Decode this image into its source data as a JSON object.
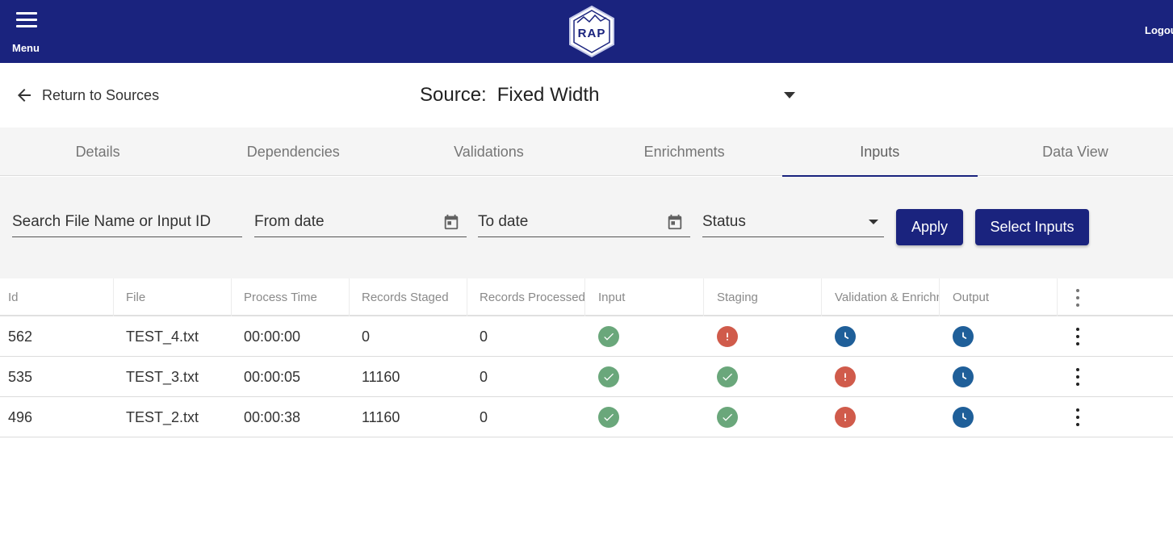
{
  "header": {
    "menu_label": "Menu",
    "logo_text": "RAP",
    "logout_label": "Logout",
    "bar_color": "#1a237e"
  },
  "subheader": {
    "return_label": "Return to Sources",
    "source_prefix": "Source:",
    "source_value": "Fixed Width"
  },
  "tabs": [
    {
      "label": "Details",
      "active": false
    },
    {
      "label": "Dependencies",
      "active": false
    },
    {
      "label": "Validations",
      "active": false
    },
    {
      "label": "Enrichments",
      "active": false
    },
    {
      "label": "Inputs",
      "active": true
    },
    {
      "label": "Data View",
      "active": false
    }
  ],
  "filters": {
    "search_placeholder": "Search File Name or Input ID",
    "from_placeholder": "From date",
    "to_placeholder": "To date",
    "status_value": "Status",
    "apply_label": "Apply",
    "select_inputs_label": "Select Inputs"
  },
  "table": {
    "columns": [
      "Id",
      "File",
      "Process Time",
      "Records Staged",
      "Records Processed",
      "Input",
      "Staging",
      "Validation & Enrichment",
      "Output"
    ],
    "rows": [
      {
        "id": "562",
        "file": "TEST_4.txt",
        "process_time": "00:00:00",
        "records_staged": "0",
        "records_processed": "0",
        "input": "ok",
        "staging": "error",
        "validation": "pending",
        "output": "pending"
      },
      {
        "id": "535",
        "file": "TEST_3.txt",
        "process_time": "00:00:05",
        "records_staged": "11160",
        "records_processed": "0",
        "input": "ok",
        "staging": "ok",
        "validation": "error",
        "output": "pending"
      },
      {
        "id": "496",
        "file": "TEST_2.txt",
        "process_time": "00:00:38",
        "records_staged": "11160",
        "records_processed": "0",
        "input": "ok",
        "staging": "ok",
        "validation": "error",
        "output": "pending"
      }
    ]
  },
  "status_colors": {
    "ok": "#6aa77b",
    "error": "#d05b4b",
    "pending": "#1f5f99"
  }
}
